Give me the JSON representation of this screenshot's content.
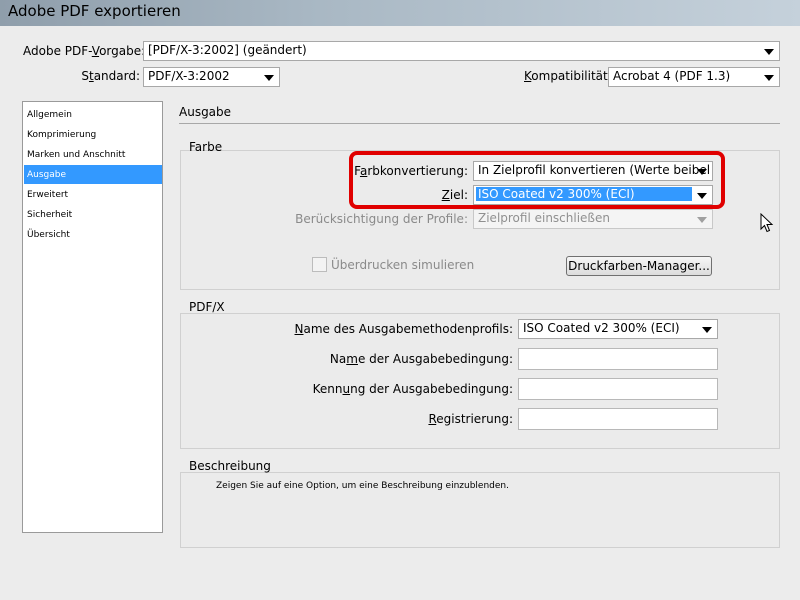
{
  "window": {
    "title": "Adobe PDF exportieren"
  },
  "header": {
    "vorgabe_label_pre": "Adobe PDF-",
    "vorgabe_label_u": "V",
    "vorgabe_label_post": "orgabe:",
    "vorgabe_value": "[PDF/X-3:2002] (geändert)",
    "standard_label_pre": "S",
    "standard_label_u": "t",
    "standard_label_post": "andard:",
    "standard_value": "PDF/X-3:2002",
    "kompat_label_u": "K",
    "kompat_label_post": "ompatibilität:",
    "kompat_value": "Acrobat 4 (PDF 1.3)"
  },
  "sidebar": {
    "items": [
      {
        "label": "Allgemein"
      },
      {
        "label": "Komprimierung"
      },
      {
        "label": "Marken und Anschnitt"
      },
      {
        "label": "Ausgabe"
      },
      {
        "label": "Erweitert"
      },
      {
        "label": "Sicherheit"
      },
      {
        "label": "Übersicht"
      }
    ],
    "active_index": 3
  },
  "main": {
    "section_title": "Ausgabe",
    "farbe": {
      "label": "Farbe",
      "konvertierung_label_pre": "F",
      "konvertierung_label_u": "a",
      "konvertierung_label_post": "rbkonvertierung:",
      "konvertierung_value": "In Zielprofil konvertieren (Werte beibel",
      "ziel_label_u": "Z",
      "ziel_label_post": "iel:",
      "ziel_value": "ISO Coated v2 300% (ECI)",
      "profile_label": "Berücksichtigung der Profile:",
      "profile_value": "Zielprofil einschließen",
      "ueberdrucken_label": "Überdrucken simulieren",
      "druckfarben_button": "Druckfarben-Manager..."
    },
    "pdfx": {
      "label": "PDF/X",
      "ausgabeprofil_label_pre": "N",
      "ausgabeprofil_label_post": "ame des Ausgabemethodenprofils:",
      "ausgabeprofil_value": "ISO Coated v2 300% (ECI)",
      "bedingung_name_label_pre": "Na",
      "bedingung_name_label_u": "m",
      "bedingung_name_label_post": "e der Ausgabebedingung:",
      "bedingung_kennung_label_pre": "Kenn",
      "bedingung_kennung_label_u": "u",
      "bedingung_kennung_label_post": "ng der Ausgabebedingung:",
      "registrierung_label_u": "R",
      "registrierung_label_post": "egistrierung:"
    },
    "beschreibung": {
      "label": "Beschreibung",
      "text": "Zeigen Sie auf eine Option, um eine Beschreibung einzublenden."
    }
  },
  "colors": {
    "accent": "#3399ff",
    "highlight_box": "#e00000"
  }
}
